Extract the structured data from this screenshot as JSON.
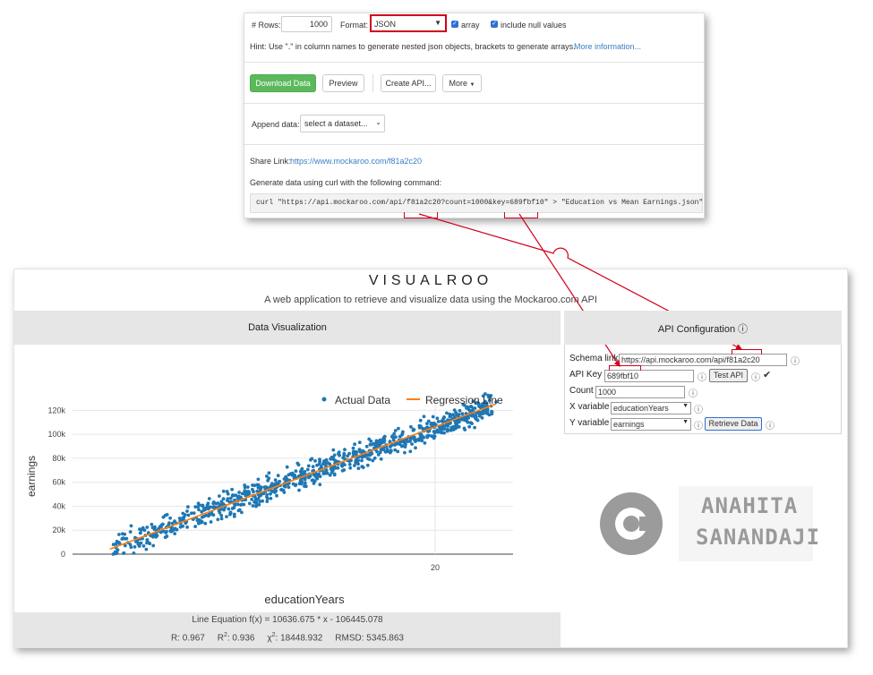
{
  "mockaroo": {
    "rows_label": "# Rows:",
    "rows_value": "1000",
    "format_label": "Format:",
    "format_value": "JSON",
    "array_label": "array",
    "include_null_label": "include null values",
    "hint_text": "Hint: Use \".\" in column names to generate nested json objects, brackets to generate arrays.",
    "more_info_link": "More information...",
    "download_button": "Download Data",
    "preview_button": "Preview",
    "create_api_button": "Create API...",
    "more_button": "More",
    "append_label": "Append data:",
    "append_select": "select a dataset...",
    "share_label": "Share Link:",
    "share_link": "https://www.mockaroo.com/f81a2c20",
    "curl_intro": "Generate data using curl with the following command:",
    "curl_command": "curl \"https://api.mockaroo.com/api/f81a2c20?count=1000&key=689fbf10\" > \"Education vs Mean Earnings.json\"",
    "accent_color": "#d0021b",
    "link_color": "#3b7fc4",
    "green_button_color": "#5cb85c"
  },
  "visualroo": {
    "title": "VISUALROO",
    "subtitle": "A web application to retrieve and visualize data using the Mockaroo.com API",
    "viz_header": "Data Visualization",
    "api_header": "API Configuration",
    "api_header_icon": "info-icon",
    "equation": "Line Equation f(x) = 10636.675 * x - 106445.078",
    "stats": {
      "r": "R: 0.967",
      "r2_label": "R",
      "r2_sup": "2",
      "r2_value": ": 0.936",
      "chi_label": "χ",
      "chi_sup": "2",
      "chi_value": ": 18448.932",
      "rmsd": "RMSD: 5345.863"
    },
    "api": {
      "schema_label": "Schema link",
      "schema_value": "https://api.mockaroo.com/api/f81a2c20",
      "key_label": "API Key",
      "key_value": "689fbf10",
      "test_button": "Test API",
      "count_label": "Count",
      "count_value": "1000",
      "x_label": "X variable",
      "x_value": "educationYears",
      "y_label": "Y variable",
      "y_value": "earnings",
      "retrieve_button": "Retrieve Data",
      "check_mark": "✔"
    },
    "watermark": {
      "symbol": "C",
      "line1": "ANAHITA",
      "line2": "SANANDAJI"
    }
  },
  "chart_data": {
    "type": "scatter",
    "xlabel": "educationYears",
    "ylabel": "earnings",
    "x_ticks": [
      "20"
    ],
    "y_ticks": [
      "0",
      "20k",
      "40k",
      "60k",
      "80k",
      "100k",
      "120k"
    ],
    "ylim": [
      0,
      130000
    ],
    "xlim": [
      9.3,
      22.3
    ],
    "grid": true,
    "legend_position": "top-right",
    "series": [
      {
        "name": "Actual Data",
        "color": "#1f77b4",
        "description_points": "approx 1000 points scattered around the regression line from x≈10 to x≈22"
      },
      {
        "name": "Regression Line",
        "color": "#ff7f0e",
        "slope": 10636.675,
        "intercept": -106445.078,
        "x_range": [
          10.4,
          21.8
        ]
      }
    ]
  }
}
